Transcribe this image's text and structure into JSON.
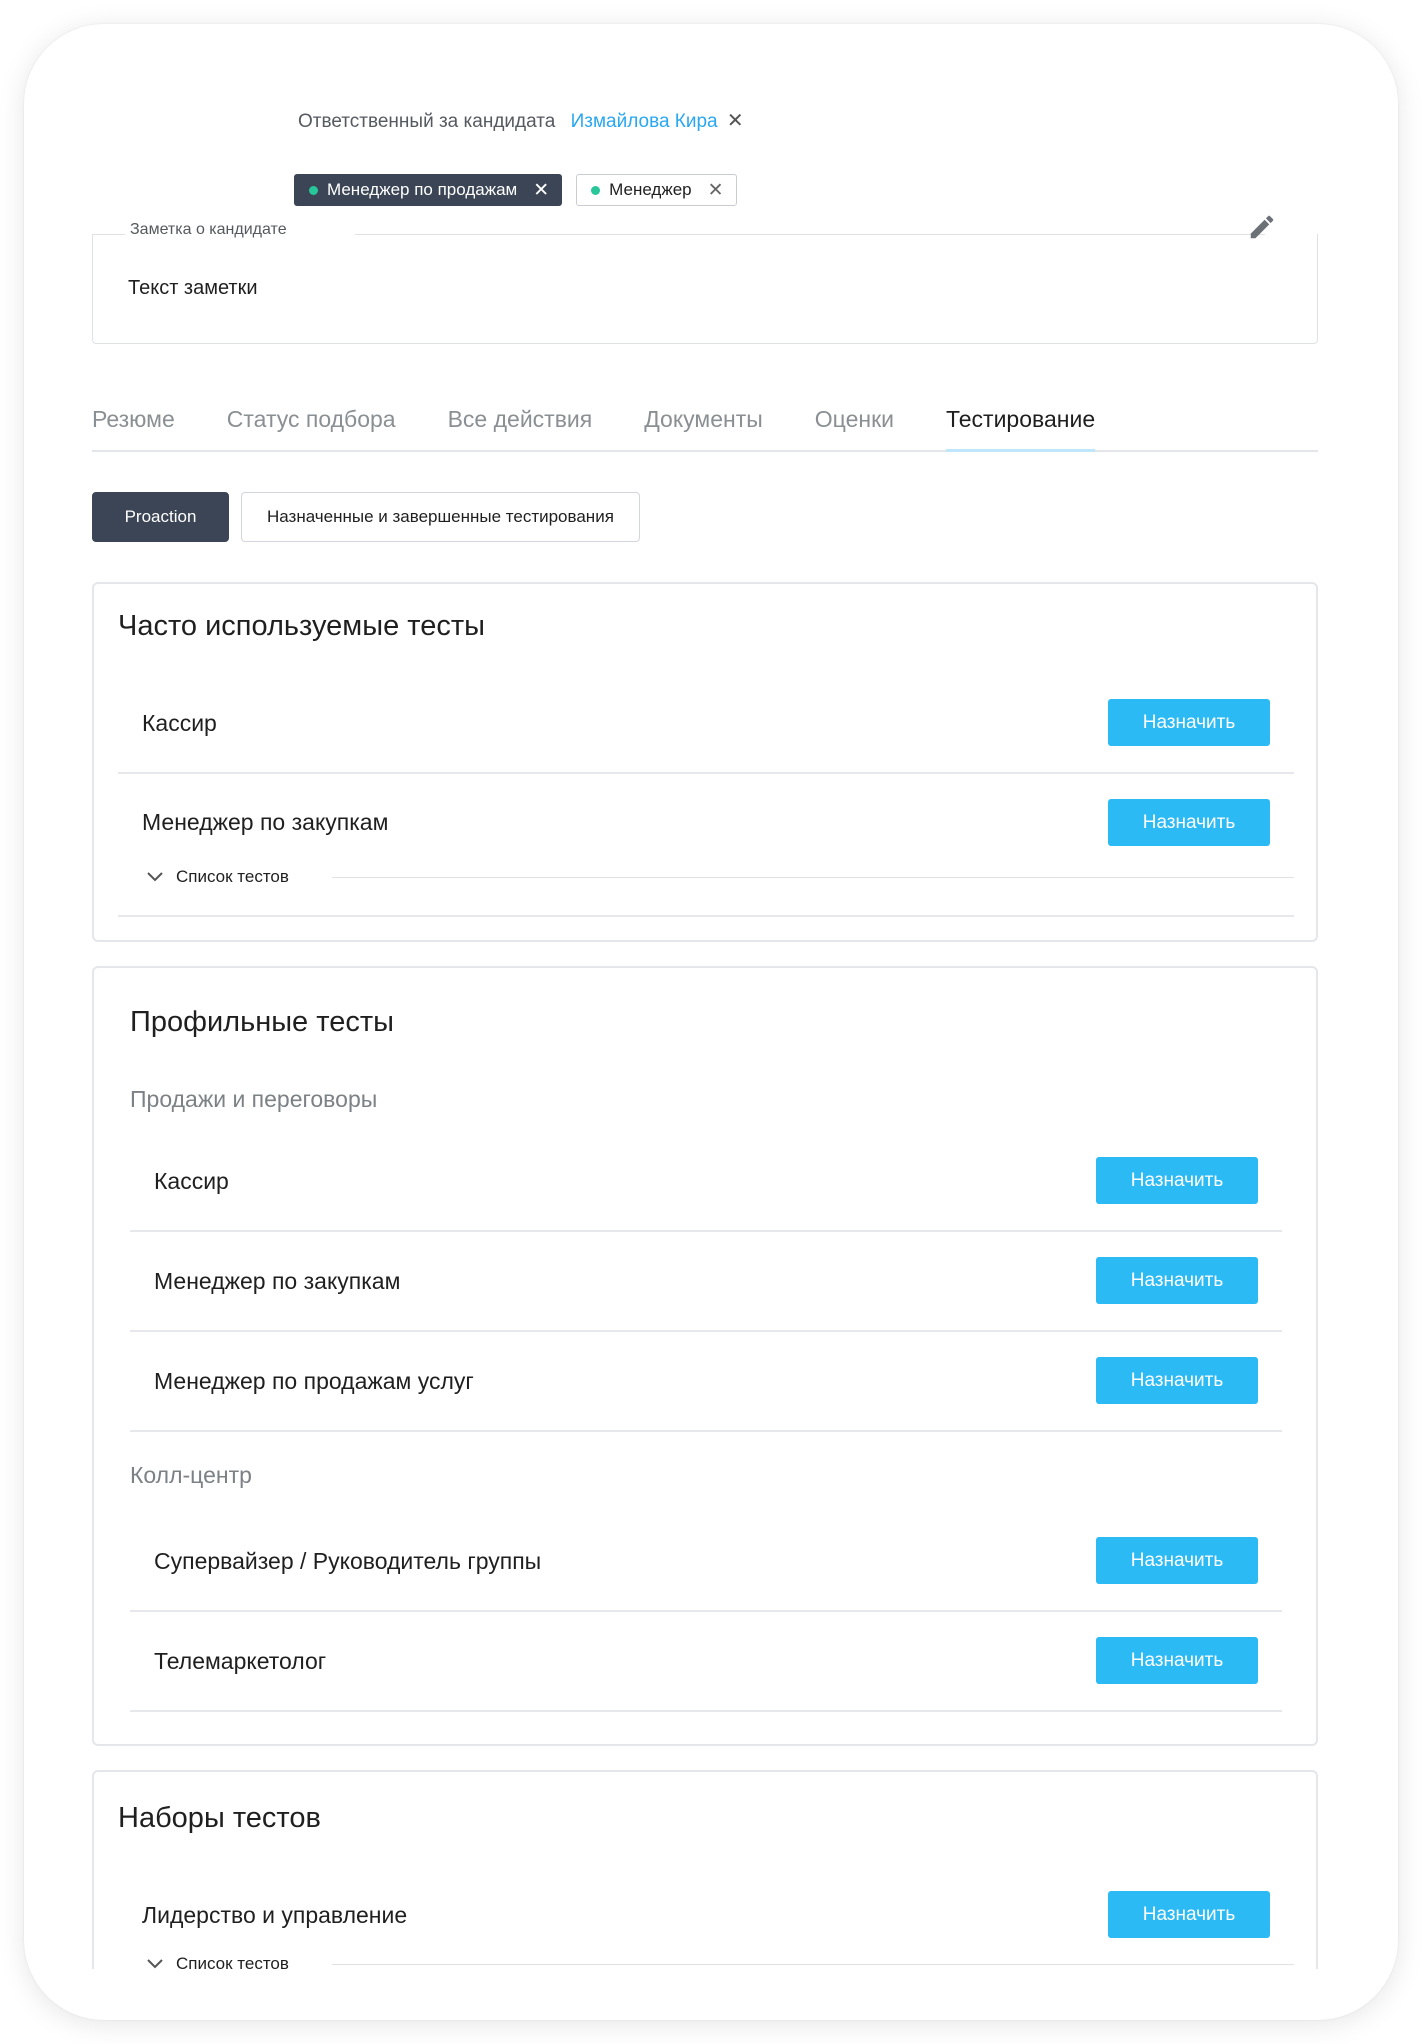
{
  "responsible": {
    "label": "Ответственный за кандидата",
    "name": "Измайлова Кира",
    "remove": "✕"
  },
  "tags": [
    {
      "label": "Менеджер по продажам",
      "style": "dark",
      "dot_color": "#27c79a",
      "remove": "✕"
    },
    {
      "label": "Менеджер",
      "style": "light",
      "dot_color": "#27c79a",
      "remove": "✕"
    }
  ],
  "note": {
    "legend": "Заметка о кандидате",
    "text": "Текст заметки",
    "edit_icon": "pencil-icon"
  },
  "tabs": [
    {
      "label": "Резюме",
      "active": false
    },
    {
      "label": "Статус подбора",
      "active": false
    },
    {
      "label": "Все действия",
      "active": false
    },
    {
      "label": "Документы",
      "active": false
    },
    {
      "label": "Оценки",
      "active": false
    },
    {
      "label": "Тестирование",
      "active": true
    }
  ],
  "subtabs": [
    {
      "label": "Proaction",
      "active": true
    },
    {
      "label": "Назначенные и завершенные тестирования",
      "active": false
    }
  ],
  "frequent": {
    "title": "Часто используемые тесты",
    "items": [
      {
        "label": "Кассир",
        "button": "Назначить"
      },
      {
        "label": "Менеджер по закупкам",
        "button": "Назначить",
        "expander": "Список тестов"
      }
    ]
  },
  "profile": {
    "title": "Профильные тесты",
    "groups": [
      {
        "title": "Продажи и переговоры",
        "items": [
          {
            "label": "Кассир",
            "button": "Назначить"
          },
          {
            "label": "Менеджер по закупкам",
            "button": "Назначить"
          },
          {
            "label": "Менеджер по продажам услуг",
            "button": "Назначить"
          }
        ]
      },
      {
        "title": "Колл-центр",
        "items": [
          {
            "label": "Супервайзер / Руководитель группы",
            "button": "Назначить"
          },
          {
            "label": "Телемаркетолог",
            "button": "Назначить"
          }
        ]
      }
    ]
  },
  "sets": {
    "title": "Наборы тестов",
    "items": [
      {
        "label": "Лидерство и управление",
        "button": "Назначить",
        "expander": "Список тестов"
      }
    ]
  },
  "colors": {
    "accent": "#2cbaf5",
    "link": "#29a7f0",
    "dark_tag": "#3b4555",
    "tag_dot": "#27c79a"
  }
}
